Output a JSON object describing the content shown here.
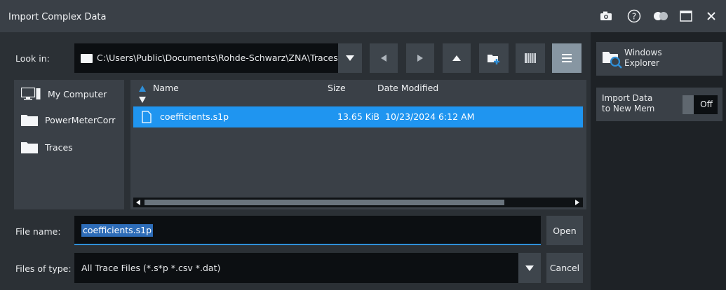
{
  "window": {
    "title": "Import Complex Data",
    "icons": [
      "camera-icon",
      "help-icon",
      "toggle-icon",
      "maximize-icon",
      "close-icon"
    ]
  },
  "look_in": {
    "label": "Look in:",
    "path": "C:\\Users\\Public\\Documents\\Rohde-Schwarz\\ZNA\\Traces"
  },
  "sidebar": {
    "items": [
      {
        "label": "My Computer",
        "icon": "computer-icon"
      },
      {
        "label": "PowerMeterCorr",
        "icon": "folder-icon"
      },
      {
        "label": "Traces",
        "icon": "folder-icon"
      }
    ]
  },
  "file_list": {
    "columns": {
      "name": "Name",
      "size": "Size",
      "modified": "Date Modified"
    },
    "rows": [
      {
        "name": "coefficients.s1p",
        "size": "13.65 KiB",
        "modified": "10/23/2024 6:12 AM",
        "selected": true
      }
    ]
  },
  "file_name": {
    "label": "File name:",
    "value": "coefficients.s1p"
  },
  "file_type": {
    "label": "Files of type:",
    "value": "All Trace Files (*.s*p *.csv *.dat)"
  },
  "buttons": {
    "open": "Open",
    "cancel": "Cancel"
  },
  "right_panel": {
    "windows_explorer_line1": "Windows",
    "windows_explorer_line2": "Explorer",
    "import_line1": "Import Data",
    "import_line2": "to New Mem",
    "import_toggle": "Off"
  },
  "colors": {
    "accent": "#1f95f0",
    "titlebar": "#3a4047",
    "background": "#2b3035"
  }
}
